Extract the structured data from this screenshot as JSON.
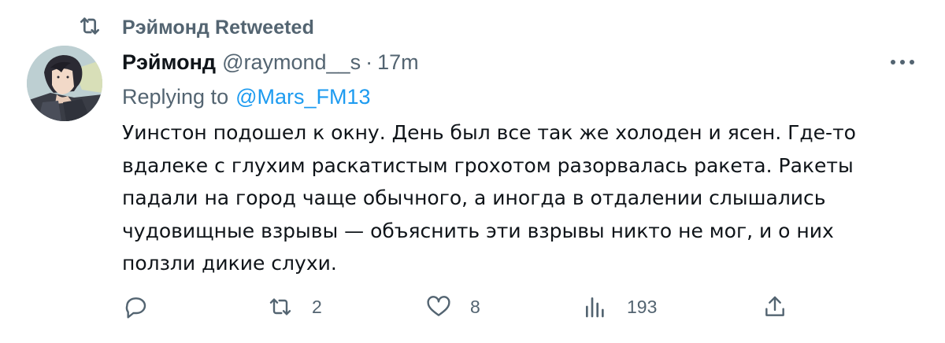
{
  "retweet_banner": {
    "icon": "retweet-icon",
    "label": "Рэймонд Retweeted"
  },
  "tweet": {
    "avatar": "user-avatar-anime-man",
    "display_name": "Рэймонд",
    "handle": "@raymond__s",
    "separator": "·",
    "time": "17m",
    "more_icon": "more-options-icon",
    "replying_prefix": "Replying to",
    "replying_to": "@Mars_FM13",
    "text": "Уинстон подошел к окну. День был все так же холоден и ясен. Где-то\nвдалеке с глухим раскатистым грохотом разорвалась ракета. Ракеты\nпадали на город чаще обычного, а иногда в отдалении слышались\nчудовищные взрывы — объяснить эти взрывы никто не мог, и о них\nползли дикие слухи."
  },
  "actions": {
    "reply": {
      "icon": "reply-icon",
      "count": ""
    },
    "retweet": {
      "icon": "retweet-icon",
      "count": "2"
    },
    "like": {
      "icon": "heart-icon",
      "count": "8"
    },
    "views": {
      "icon": "analytics-icon",
      "count": "193"
    },
    "share": {
      "icon": "share-icon",
      "count": ""
    }
  },
  "colors": {
    "text": "#0f1419",
    "secondary": "#536471",
    "link": "#1d9bf0"
  }
}
